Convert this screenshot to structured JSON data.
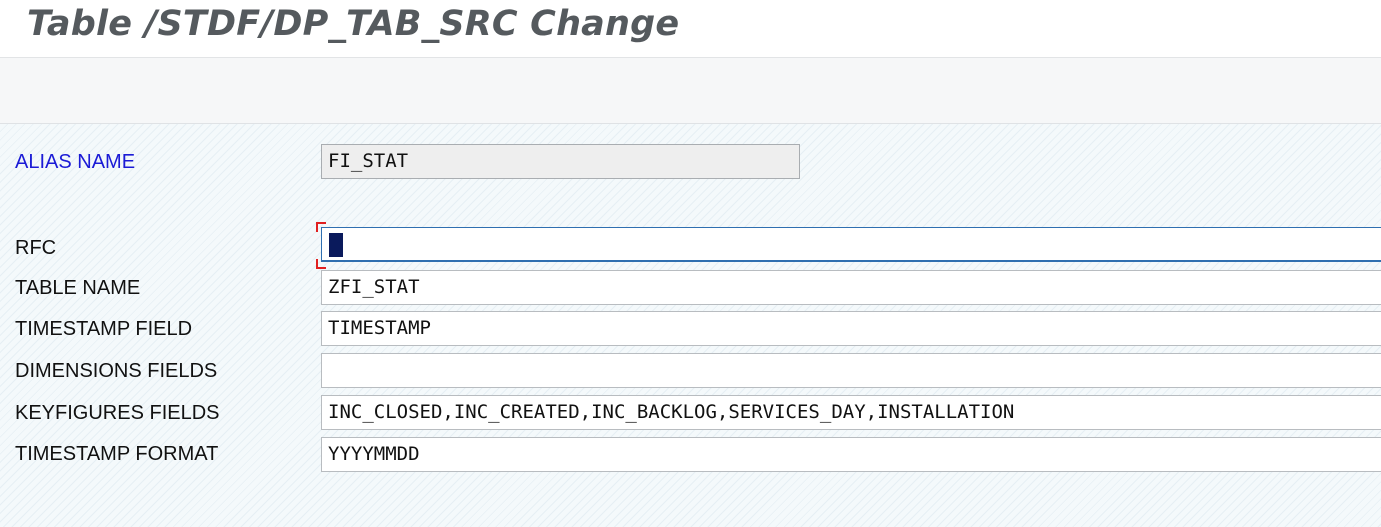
{
  "window": {
    "title": "Table /STDF/DP_TAB_SRC Change"
  },
  "form": {
    "alias_name": {
      "label": "ALIAS NAME",
      "value": "FI_STAT"
    },
    "rfc": {
      "label": "RFC",
      "value": ""
    },
    "table_name": {
      "label": "TABLE NAME",
      "value": "ZFI_STAT"
    },
    "timestamp_field": {
      "label": "TIMESTAMP FIELD",
      "value": "TIMESTAMP"
    },
    "dimensions_fields": {
      "label": "DIMENSIONS FIELDS",
      "value": ""
    },
    "keyfigures_fields": {
      "label": "KEYFIGURES FIELDS",
      "value": "INC_CLOSED,INC_CREATED,INC_BACKLOG,SERVICES_DAY,INSTALLATION"
    },
    "timestamp_format": {
      "label": "TIMESTAMP FORMAT",
      "value": "YYYYMMDD"
    }
  },
  "colors": {
    "title_text": "#555a5e",
    "key_label": "#1b1bd6",
    "focus_border": "#2f6fb0",
    "focus_marker": "#e02020",
    "cursor": "#0a1a5c"
  }
}
